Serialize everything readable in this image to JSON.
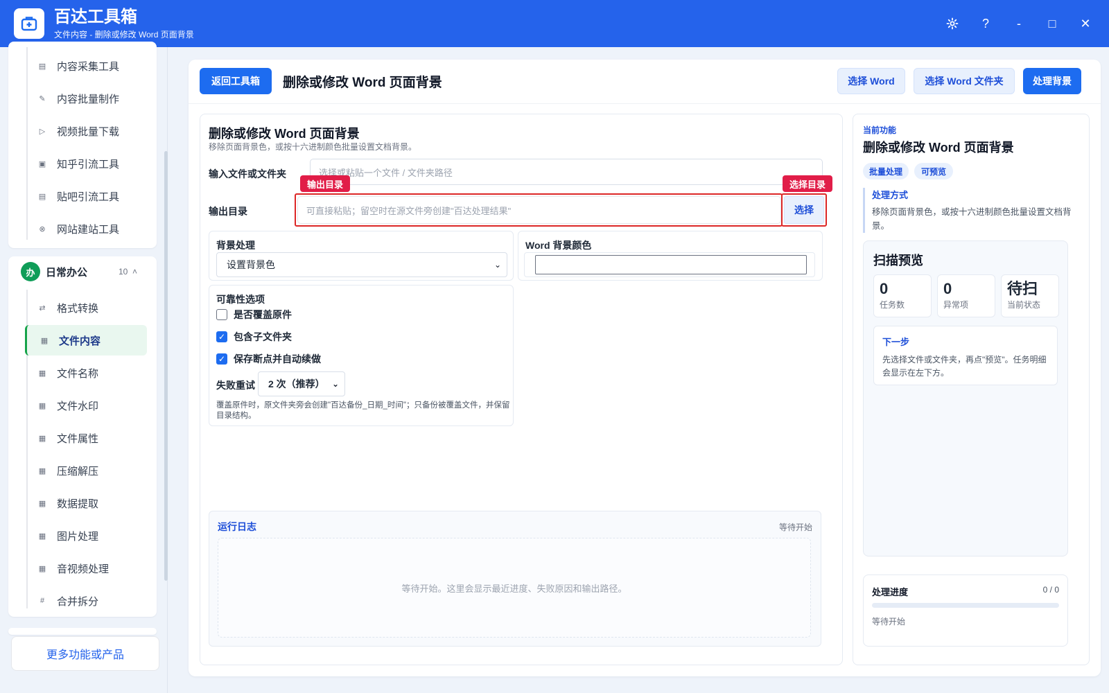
{
  "app": {
    "title": "百达工具箱",
    "subtitle": "文件内容 - 删除或修改 Word 页面背景"
  },
  "window_controls": {
    "settings_icon": "gear-icon",
    "help": "?",
    "minimize": "-",
    "maximize": "□",
    "close": "✕"
  },
  "sidebar": {
    "top_items": [
      {
        "icon": "▤",
        "label": "内容采集工具"
      },
      {
        "icon": "✎",
        "label": "内容批量制作"
      },
      {
        "icon": "▷",
        "label": "视频批量下载"
      },
      {
        "icon": "▣",
        "label": "知乎引流工具"
      },
      {
        "icon": "▤",
        "label": "贴吧引流工具"
      },
      {
        "icon": "⊗",
        "label": "网站建站工具"
      }
    ],
    "group": {
      "badge": "办",
      "title": "日常办公",
      "count": "10",
      "chevron": "˄"
    },
    "group_items": [
      {
        "icon": "⇄",
        "label": "格式转换"
      },
      {
        "icon": "▦",
        "label": "文件内容"
      },
      {
        "icon": "▦",
        "label": "文件名称"
      },
      {
        "icon": "▦",
        "label": "文件水印"
      },
      {
        "icon": "▦",
        "label": "文件属性"
      },
      {
        "icon": "▦",
        "label": "压缩解压"
      },
      {
        "icon": "▦",
        "label": "数据提取"
      },
      {
        "icon": "▦",
        "label": "图片处理"
      },
      {
        "icon": "▦",
        "label": "音视频处理"
      },
      {
        "icon": "#",
        "label": "合并拆分"
      }
    ],
    "more_button": "更多功能或产品"
  },
  "toolbar": {
    "back_label": "返回工具箱",
    "page_title": "删除或修改 Word 页面背景",
    "select_word": "选择 Word",
    "select_word_folder": "选择 Word 文件夹",
    "process_bg": "处理背景"
  },
  "form": {
    "title": "删除或修改 Word 页面背景",
    "subtitle": "移除页面背景色，或按十六进制颜色批量设置文档背景。",
    "input_label": "输入文件或文件夹",
    "input_placeholder": "选择或粘贴一个文件 / 文件夹路径",
    "output_label": "输出目录",
    "output_placeholder": "可直接粘贴；留空时在源文件旁创建\"百达处理结果\"",
    "choose_button": "选择",
    "hint_output": "输出目录",
    "hint_choose": "选择目录",
    "bg_process": {
      "title": "背景处理",
      "selected": "设置背景色",
      "chevron": "⌄"
    },
    "bg_color": {
      "title": "Word 背景颜色",
      "value": ""
    },
    "reliability": {
      "title": "可靠性选项",
      "options": [
        {
          "label": "是否覆盖原件",
          "checked": false
        },
        {
          "label": "包含子文件夹",
          "checked": true
        },
        {
          "label": "保存断点并自动续做",
          "checked": true
        }
      ],
      "retry_label": "失败重试",
      "retry_selected": "2 次（推荐）",
      "note": "覆盖原件时，原文件夹旁会创建\"百达备份_日期_时间\"；只备份被覆盖文件，并保留目录结构。"
    }
  },
  "log": {
    "title": "运行日志",
    "status": "等待开始",
    "empty_text": "等待开始。这里会显示最近进度、失败原因和输出路径。"
  },
  "info": {
    "kicker": "当前功能",
    "title": "删除或修改 Word 页面背景",
    "tags": [
      "批量处理",
      "可预览"
    ],
    "method_title": "处理方式",
    "method_text": "移除页面背景色，或按十六进制颜色批量设置文档背景。",
    "scan": {
      "title": "扫描预览",
      "stats": [
        {
          "value": "0",
          "label": "任务数"
        },
        {
          "value": "0",
          "label": "异常项"
        },
        {
          "value": "待扫",
          "label": "当前状态"
        }
      ],
      "next_title": "下一步",
      "next_text": "先选择文件或文件夹，再点\"预览\"。任务明细会显示在左下方。"
    },
    "progress": {
      "title": "处理进度",
      "count": "0 / 0",
      "fraction": 0,
      "status": "等待开始"
    }
  },
  "colors": {
    "brand": "#2563eb",
    "accent": "#1d6cf0",
    "highlight": "#dc2626",
    "active_group": "#0f9d58"
  }
}
